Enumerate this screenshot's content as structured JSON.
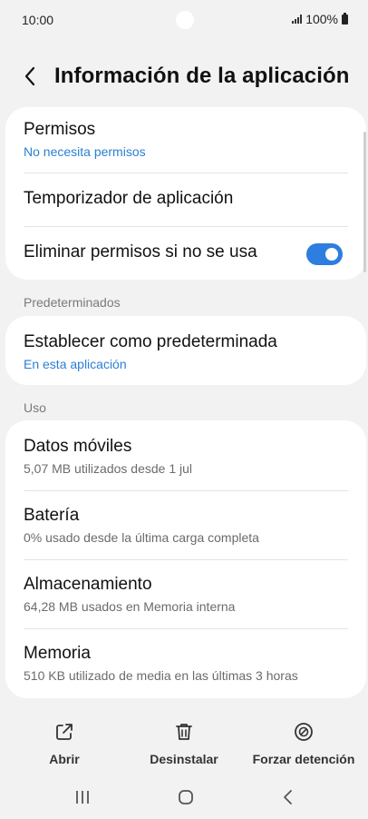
{
  "status_bar": {
    "time": "10:00",
    "battery": "100%"
  },
  "header": {
    "title": "Información de la aplicación"
  },
  "permissions_card": {
    "permisos": {
      "label": "Permisos",
      "sub": "No necesita permisos"
    },
    "temporizador": {
      "label": "Temporizador de aplicación"
    },
    "eliminar": {
      "label": "Eliminar permisos si no se usa",
      "toggle_on": true
    }
  },
  "sections": {
    "predeterminados": "Predeterminados",
    "uso": "Uso"
  },
  "default_card": {
    "label": "Establecer como predeterminada",
    "sub": "En esta aplicación"
  },
  "usage_items": [
    {
      "label": "Datos móviles",
      "sub": "5,07 MB utilizados desde 1 jul"
    },
    {
      "label": "Batería",
      "sub": "0% usado desde la última carga completa"
    },
    {
      "label": "Almacenamiento",
      "sub": "64,28 MB usados en Memoria interna"
    },
    {
      "label": "Memoria",
      "sub": "510 KB utilizado de media en las últimas 3 horas"
    }
  ],
  "actions": {
    "abrir": "Abrir",
    "desinstalar": "Desinstalar",
    "forzar": "Forzar detención"
  },
  "icons": {
    "back": "chevron-left-icon",
    "open": "open-external-icon",
    "uninstall": "trash-icon",
    "force_stop": "stop-circle-icon",
    "recents": "recents-icon",
    "home": "home-icon",
    "nav_back": "nav-back-icon"
  },
  "colors": {
    "accent": "#2e7de0",
    "link": "#2b7fd4"
  }
}
